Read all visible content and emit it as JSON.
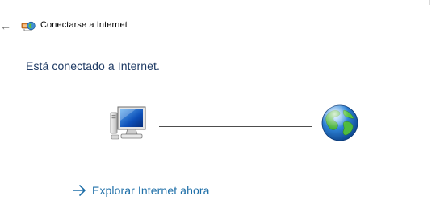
{
  "window": {
    "title": "Conectarse a Internet"
  },
  "header": {
    "back_icon": "back-arrow-icon",
    "app_icon": "network-connect-icon"
  },
  "status": {
    "message": "Está conectado a Internet."
  },
  "diagram": {
    "left_icon": "computer-icon",
    "right_icon": "globe-icon"
  },
  "actions": {
    "browse_label": "Explorar Internet ahora",
    "browse_icon": "arrow-right-icon"
  },
  "colors": {
    "heading": "#1e3a64",
    "link": "#1e6fa8",
    "line": "#4d4d4d"
  }
}
